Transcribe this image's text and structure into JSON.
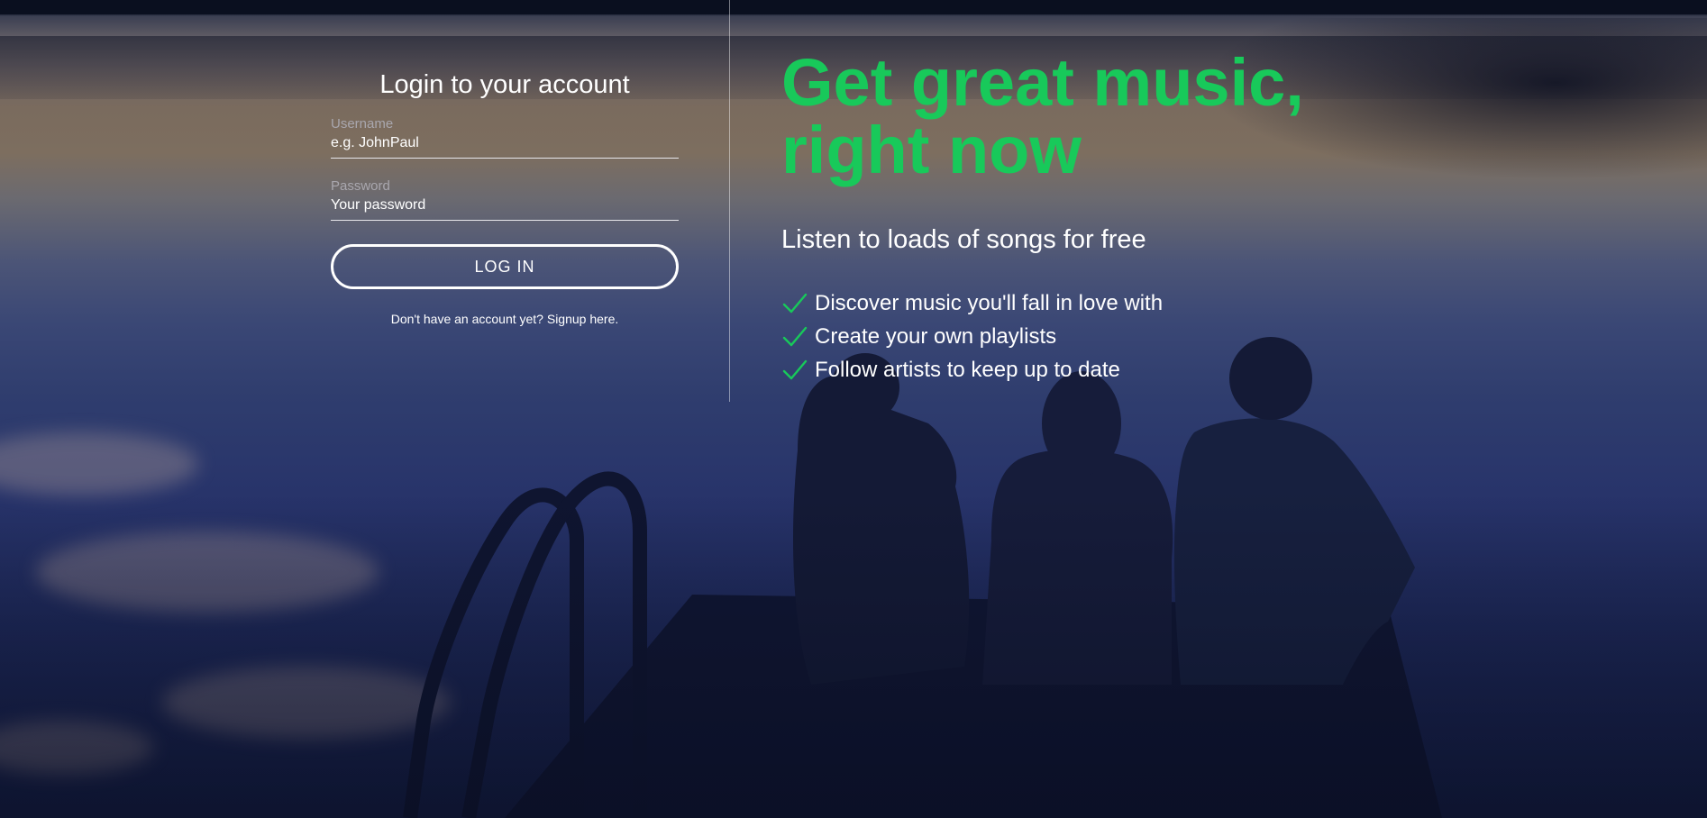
{
  "background": {
    "description_icon": "lake-dock-photo",
    "accent_color": "#18c95a"
  },
  "login": {
    "title": "Login to your account",
    "username": {
      "label": "Username",
      "placeholder": "e.g. JohnPaul"
    },
    "password": {
      "label": "Password",
      "placeholder": "Your password"
    },
    "login_button": "LOG IN",
    "signup_link": "Don't have an account yet? Signup here."
  },
  "promo": {
    "headline_line1": "Get great music,",
    "headline_line2": "right now",
    "subheading": "Listen to loads of songs for free",
    "features": [
      "Discover music you'll fall in love with",
      "Create your own playlists",
      "Follow artists to keep up to date"
    ],
    "check_icon": "check-icon"
  }
}
